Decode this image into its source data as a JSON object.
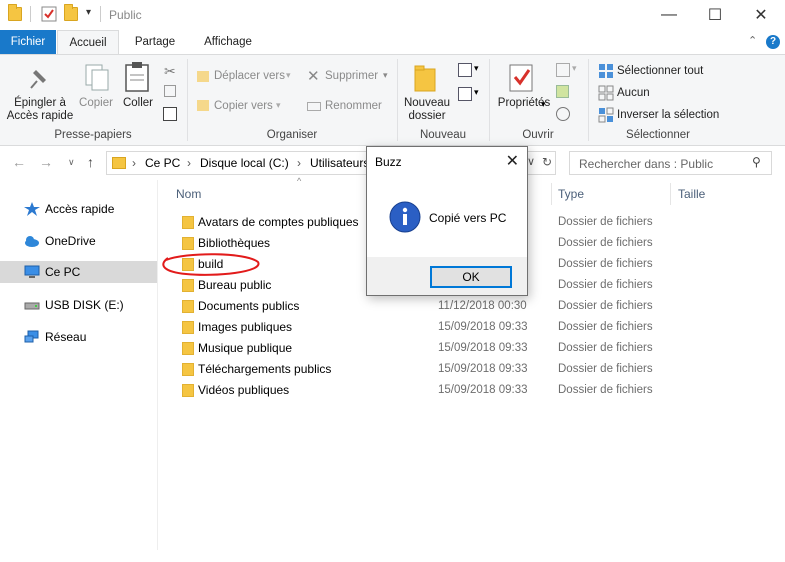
{
  "window": {
    "title": "Public"
  },
  "tabs": {
    "file": "Fichier",
    "home": "Accueil",
    "share": "Partage",
    "view": "Affichage"
  },
  "ribbon": {
    "pin": "Épingler à",
    "pin2": "Accès rapide",
    "copy": "Copier",
    "paste": "Coller",
    "clipboard_group": "Presse-papiers",
    "move_to": "Déplacer vers",
    "copy_to": "Copier vers",
    "delete": "Supprimer",
    "rename": "Renommer",
    "organize_group": "Organiser",
    "new_folder": "Nouveau",
    "new_folder2": "dossier",
    "new_group": "Nouveau",
    "properties": "Propriétés",
    "open_group": "Ouvrir",
    "select_all": "Sélectionner tout",
    "select_none": "Aucun",
    "invert": "Inverser la sélection",
    "select_group": "Sélectionner"
  },
  "address": {
    "segments": [
      "Ce PC",
      "Disque local (C:)",
      "Utilisateurs"
    ]
  },
  "search": {
    "placeholder": "Rechercher dans : Public"
  },
  "sidebar": {
    "items": [
      {
        "label": "Accès rapide"
      },
      {
        "label": "OneDrive"
      },
      {
        "label": "Ce PC"
      },
      {
        "label": "USB DISK (E:)"
      },
      {
        "label": "Réseau"
      }
    ]
  },
  "columns": {
    "name": "Nom",
    "type": "Type",
    "size": "Taille"
  },
  "files": [
    {
      "name": "Avatars de comptes publiques",
      "date": "",
      "type": "Dossier de fichiers"
    },
    {
      "name": "Bibliothèques",
      "date": "",
      "type": "Dossier de fichiers"
    },
    {
      "name": "build",
      "date": "",
      "type": "Dossier de fichiers"
    },
    {
      "name": "Bureau public",
      "date": "",
      "type": "Dossier de fichiers"
    },
    {
      "name": "Documents publics",
      "date": "11/12/2018 00:30",
      "type": "Dossier de fichiers"
    },
    {
      "name": "Images publiques",
      "date": "15/09/2018 09:33",
      "type": "Dossier de fichiers"
    },
    {
      "name": "Musique publique",
      "date": "15/09/2018 09:33",
      "type": "Dossier de fichiers"
    },
    {
      "name": "Téléchargements publics",
      "date": "15/09/2018 09:33",
      "type": "Dossier de fichiers"
    },
    {
      "name": "Vidéos publiques",
      "date": "15/09/2018 09:33",
      "type": "Dossier de fichiers"
    }
  ],
  "dialog": {
    "title": "Buzz",
    "message": "Copié vers PC",
    "ok": "OK"
  },
  "colors": {
    "accent": "#1979ca",
    "selected": "#cce8ff",
    "annotation": "#e21b1b"
  }
}
